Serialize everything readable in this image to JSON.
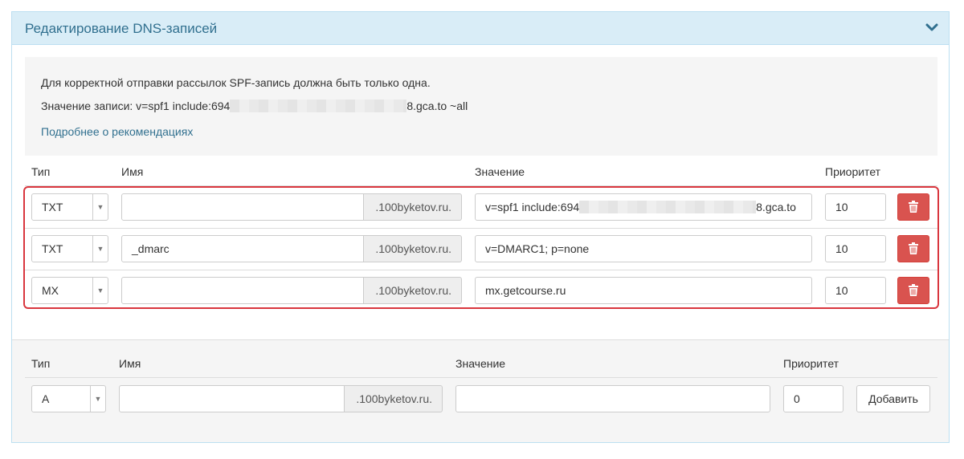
{
  "panel": {
    "title": "Редактирование DNS-записей",
    "collapse_icon": "chevron-down-icon"
  },
  "info": {
    "line1": "Для корректной отправки рассылок SPF-запись должна быть только одна.",
    "line2_prefix": "Значение записи: v=spf1 include:694",
    "line2_suffix": "8.gca.to ~all",
    "link_label": "Подробнее о рекомендациях"
  },
  "columns": {
    "type": "Тип",
    "name": "Имя",
    "value": "Значение",
    "priority": "Приоритет"
  },
  "records": [
    {
      "type": "TXT",
      "name": "",
      "domain_suffix": ".100byketov.ru.",
      "value_prefix": "v=spf1 include:694",
      "value_suffix": "8.gca.to",
      "priority": "10"
    },
    {
      "type": "TXT",
      "name": "_dmarc",
      "domain_suffix": ".100byketov.ru.",
      "value_prefix": "v=DMARC1; p=none",
      "value_suffix": "",
      "priority": "10"
    },
    {
      "type": "MX",
      "name": "",
      "domain_suffix": ".100byketov.ru.",
      "value_prefix": "mx.getcourse.ru",
      "value_suffix": "",
      "priority": "10"
    }
  ],
  "new_record": {
    "type": "A",
    "name": "",
    "domain_suffix": ".100byketov.ru.",
    "value": "",
    "priority": "0",
    "add_label": "Добавить"
  },
  "colors": {
    "header_bg": "#d9edf7",
    "header_text": "#31708f",
    "danger": "#d9534f",
    "highlight_border": "#d9363e"
  }
}
